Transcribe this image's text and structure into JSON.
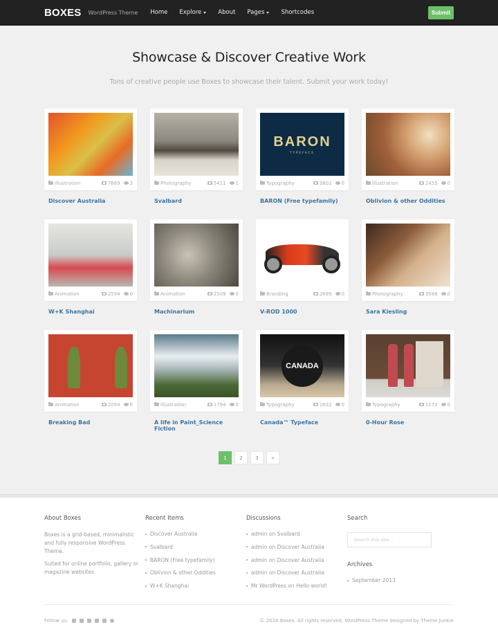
{
  "header": {
    "logo": "BOXES",
    "tagline": "WordPress Theme",
    "nav": [
      {
        "label": "Home",
        "dropdown": false
      },
      {
        "label": "Explore",
        "dropdown": true
      },
      {
        "label": "About",
        "dropdown": false
      },
      {
        "label": "Pages",
        "dropdown": true
      },
      {
        "label": "Shortcodes",
        "dropdown": false
      }
    ],
    "submit_label": "Submit"
  },
  "hero": {
    "title": "Showcase & Discover Creative Work",
    "subtitle": "Tons of creative people use Boxes to showcase their talent. Submit your work today!"
  },
  "items": [
    {
      "title": "Discover Australia",
      "category": "Illustration",
      "views": "7669",
      "comments": "3"
    },
    {
      "title": "Svalbard",
      "category": "Photography",
      "views": "5411",
      "comments": "1"
    },
    {
      "title": "BARON (Free typefamily)",
      "category": "Typography",
      "views": "3802",
      "comments": "0",
      "thumb_text": "BARON",
      "thumb_sub": "TYPEFACE"
    },
    {
      "title": "Oblivion & other Oddities",
      "category": "Illustration",
      "views": "2455",
      "comments": "0"
    },
    {
      "title": "W+K Shanghai",
      "category": "Animation",
      "views": "2594",
      "comments": "0"
    },
    {
      "title": "Machinarium",
      "category": "Animation",
      "views": "2509",
      "comments": "0"
    },
    {
      "title": "V-ROD 1000",
      "category": "Branding",
      "views": "2699",
      "comments": "0"
    },
    {
      "title": "Sara Kiesling",
      "category": "Photography",
      "views": "3588",
      "comments": "0"
    },
    {
      "title": "Breaking Bad",
      "category": "Animation",
      "views": "2094",
      "comments": "0"
    },
    {
      "title": "A life in Paint_Science Fiction",
      "category": "Illustration",
      "views": "1794",
      "comments": "0"
    },
    {
      "title": "Canada™ Typeface",
      "category": "Typography",
      "views": "1632",
      "comments": "0",
      "thumb_text": "CANADA"
    },
    {
      "title": "0-Hour Rose",
      "category": "Typography",
      "views": "1172",
      "comments": "0"
    }
  ],
  "pagination": {
    "pages": [
      "1",
      "2",
      "3"
    ],
    "current": "1",
    "next_label": "»"
  },
  "footer": {
    "about": {
      "heading": "About Boxes",
      "paragraphs": [
        "Boxes is a grid-based, minimalistic and fully responsive WordPress Theme.",
        "Suited for online portfolio, gallery or magazine websites."
      ]
    },
    "recent": {
      "heading": "Recent Items",
      "items": [
        "Discover Australia",
        "Svalbard",
        "BARON (Free typefamily)",
        "Oblivion & other Oddities",
        "W+K Shanghai"
      ]
    },
    "discussions": {
      "heading": "Discussions",
      "items": [
        "admin on Svalbard",
        "admin on Discover Australia",
        "admin on Discover Australia",
        "admin on Discover Australia",
        "Mr WordPress on Hello world!"
      ]
    },
    "search": {
      "heading": "Search",
      "placeholder": "Search this site..."
    },
    "archives": {
      "heading": "Archives",
      "items": [
        "September 2013"
      ]
    },
    "follow_label": "Follow us:",
    "social": [
      "rss-icon",
      "email-icon",
      "twitter-icon",
      "facebook-icon",
      "google-plus-icon",
      "pinterest-icon"
    ],
    "copyright": "© 2016 Boxes. All rights reserved. WordPress Theme designed by Theme Junkie"
  },
  "colors": {
    "accent_green": "#6cc06a",
    "link_blue": "#3a74a3",
    "header_bg": "#222222"
  }
}
